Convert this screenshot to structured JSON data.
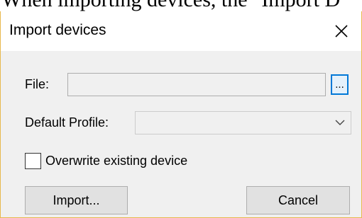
{
  "document": {
    "fragment_text": "When importing devices, the \"Import D"
  },
  "dialog": {
    "title": "Import devices",
    "close_icon": "close-icon",
    "file": {
      "label": "File:",
      "value": "",
      "browse_label": "..."
    },
    "default_profile": {
      "label": "Default Profile:",
      "selected": "",
      "chevron_icon": "chevron-down-icon"
    },
    "overwrite": {
      "label": "Overwrite existing device",
      "checked": false
    },
    "buttons": {
      "import_label": "Import...",
      "cancel_label": "Cancel"
    }
  },
  "colors": {
    "dialog_background": "#f0f0f0",
    "titlebar_background": "#ffffff",
    "dialog_border": "#e8b84c",
    "focus_accent": "#0078d7",
    "button_face": "#e1e1e1",
    "button_border": "#adadad"
  }
}
